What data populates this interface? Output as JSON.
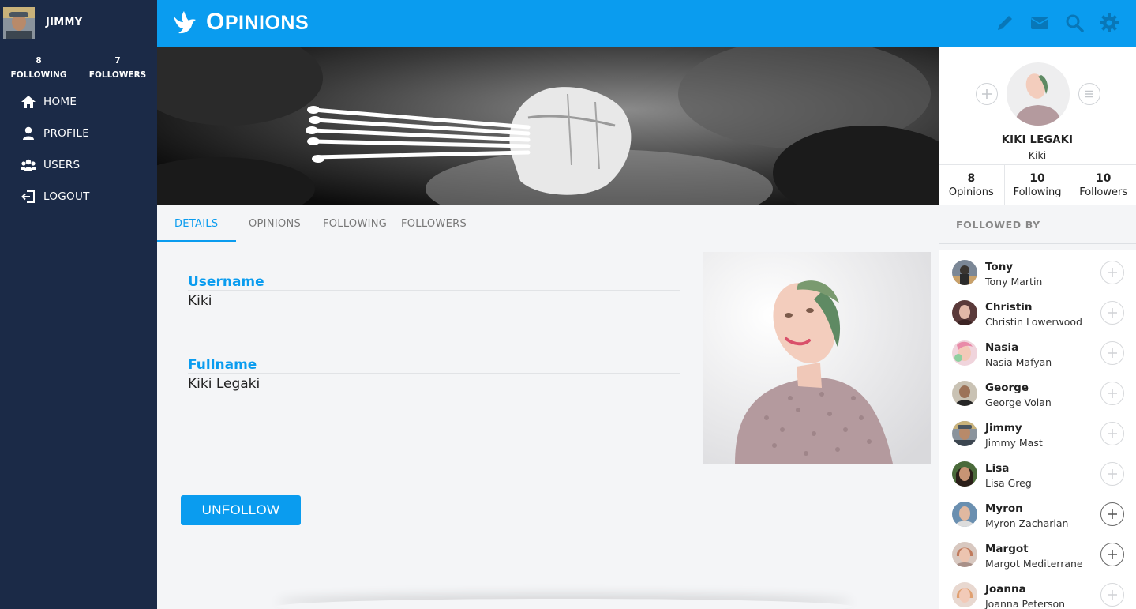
{
  "user": {
    "name": "JIMMY",
    "following_count": "8",
    "following_label": "FOLLOWING",
    "followers_count": "7",
    "followers_label": "FOLLOWERS"
  },
  "nav": {
    "home": "HOME",
    "profile": "PROFILE",
    "users": "USERS",
    "logout": "LOGOUT"
  },
  "app": {
    "title_initial": "O",
    "title_rest": "PINIONS",
    "accent_color": "#0a9cef",
    "sidebar_color": "#1b2a47",
    "top_icons": [
      "pencil-icon",
      "mail-icon",
      "search-icon",
      "gear-icon"
    ]
  },
  "tabs": [
    "DETAILS",
    "OPINIONS",
    "FOLLOWING",
    "FOLLOWERS"
  ],
  "details": {
    "username_label": "Username",
    "username_value": "Kiki",
    "fullname_label": "Fullname",
    "fullname_value": "Kiki Legaki",
    "unfollow_label": "UNFOLLOW"
  },
  "profile_card": {
    "name": "KIKI LEGAKI",
    "username": "Kiki",
    "stats": [
      {
        "value": "8",
        "label": "Opinions"
      },
      {
        "value": "10",
        "label": "Following"
      },
      {
        "value": "10",
        "label": "Followers"
      }
    ]
  },
  "followed_by": {
    "title": "FOLLOWED BY",
    "items": [
      {
        "name": "Tony",
        "fullname": "Tony Martin"
      },
      {
        "name": "Christin",
        "fullname": "Christin Lowerwood"
      },
      {
        "name": "Nasia",
        "fullname": "Nasia Mafyan"
      },
      {
        "name": "George",
        "fullname": "George Volan"
      },
      {
        "name": "Jimmy",
        "fullname": "Jimmy Mast"
      },
      {
        "name": "Lisa",
        "fullname": "Lisa Greg"
      },
      {
        "name": "Myron",
        "fullname": "Myron Zacharian"
      },
      {
        "name": "Margot",
        "fullname": "Margot Mediterrane"
      },
      {
        "name": "Joanna",
        "fullname": "Joanna Peterson"
      }
    ]
  }
}
